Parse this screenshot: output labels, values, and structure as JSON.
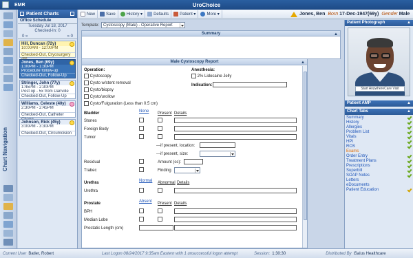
{
  "app": {
    "name": "EMR",
    "title": "UroChoice"
  },
  "toolbar": {
    "new": "New",
    "save": "Save",
    "history": "History",
    "defaults": "Defaults",
    "patient": "Patient",
    "more": "More"
  },
  "banner": {
    "name": "Jones, Ben",
    "born_label": "Born",
    "dob": "17-Dec-1947(69y)",
    "gender_label": "Gender",
    "gender": "Male"
  },
  "patient_charts": {
    "title": "Patient Charts",
    "schedule_label": "Office Schedule",
    "date": "Tuesday Jul 18, 2017",
    "checked_in": "Checked-In: 0",
    "nav_prev": "0 »",
    "nav_next": "» 0",
    "cards": [
      {
        "name": "Hill, Duncan (72y)",
        "time": "10:00AM - 12:00PM",
        "status": "Checked-Out, Cryosurgery (55",
        "style": "hl"
      },
      {
        "name": "Jones, Ben (69y)",
        "time": "1:00PM - 1:30PM",
        "reason": "Procedure follow-up",
        "status": "Checked-Out, Follow-Up",
        "style": "sel"
      },
      {
        "name": "Stringer, John (77y)",
        "time": "1:45PM - 2:30PM",
        "reason": "Post op - 5x from Danville",
        "status": "Checked-Out, Follow-Up",
        "style": "plain"
      },
      {
        "name": "Williams, Celeste (40y)",
        "time": "2:30PM - 2:45PM",
        "status": "Checked-Out, Catheter Chang",
        "style": "plain"
      },
      {
        "name": "Johnson, Rick (45y)",
        "time": "3:00PM - 3:30PM",
        "status": "Checked-Out, Circumcision",
        "style": "plain"
      }
    ]
  },
  "left_nav": {
    "label": "Chart Navigation"
  },
  "template": {
    "label": "Template:",
    "value": "Cystoscopy (Male) - Operative Report"
  },
  "summary": {
    "title": "Summary"
  },
  "note": {
    "title": "Male Cystoscopy Report",
    "operation_label": "Operation:",
    "operations": [
      "Cystoscopy",
      "Cysto w/stent removal",
      "Cysto/biopsy",
      "Cysto/urollow",
      "Cysto/Fulguration (Less than 0.5 cm)"
    ],
    "anesthesia_label": "Anesthesia:",
    "anesthesia_option": "2% Lidocaine Jelly",
    "indication_label": "Indication:",
    "bladder_label": "Bladder",
    "none_label": "None",
    "present_label": "Present",
    "details_label": "Details",
    "bladder_items": [
      "Stones",
      "Foreign Body",
      "Tumor"
    ],
    "location_label": "---if present, location:",
    "size_label": "---if present, size:",
    "residual_label": "Residual",
    "trabec_label": "Trabec",
    "amount_label": "Amount (cc):",
    "finding_label": "Finding",
    "urethra_label": "Urethra",
    "normal_label": "Normal",
    "abnormal_label": "Abnormal",
    "urethra_item": "Urethra",
    "prostate_label": "Prostate",
    "absent_label": "Absent",
    "prostate_items": [
      "BPH",
      "Median Lobe"
    ],
    "prostatic_length_label": "Prostatic Length (cm)"
  },
  "right": {
    "photo_title": "Patient Photograph",
    "photo_banner": "Start AnywhereCare Visit",
    "amp_title": "Patient AMP",
    "tabs_title": "Chart Tabs",
    "tabs": [
      {
        "label": "Summary",
        "check": "green",
        "style": "link"
      },
      {
        "label": "History",
        "check": "green",
        "style": "link"
      },
      {
        "label": "Allergies",
        "check": "green",
        "style": "link"
      },
      {
        "label": "Problem List",
        "check": "green",
        "style": "link"
      },
      {
        "label": "Vitals",
        "check": "green",
        "style": "link"
      },
      {
        "label": "HPI",
        "check": "green",
        "style": "link"
      },
      {
        "label": "ROS",
        "check": "green",
        "style": "link"
      },
      {
        "label": "Exams",
        "check": "",
        "style": "cur"
      },
      {
        "label": "Order Entry",
        "check": "green",
        "style": "link"
      },
      {
        "label": "Treatment Plans",
        "check": "green",
        "style": "link"
      },
      {
        "label": "Prescriptions",
        "check": "green",
        "style": "link"
      },
      {
        "label": "Superbill",
        "check": "green",
        "style": "link"
      },
      {
        "label": "SOAP Notes",
        "check": "green",
        "style": "link"
      },
      {
        "label": "Letters",
        "check": "",
        "style": "link"
      },
      {
        "label": "eDocuments",
        "check": "",
        "style": "link"
      },
      {
        "label": "Patient Education",
        "check": "yellow",
        "style": "link"
      }
    ]
  },
  "status": {
    "current_user_label": "Current User",
    "current_user": "Batler, Robert",
    "last_logon": "Last Logon 08/24/2017 9:35am Eastern with 1 unsuccessful logon attempt",
    "session_label": "Session:",
    "session": "1:30:30",
    "distributed_label": "Distributed By",
    "distributor": "iSalus Healthcare"
  }
}
